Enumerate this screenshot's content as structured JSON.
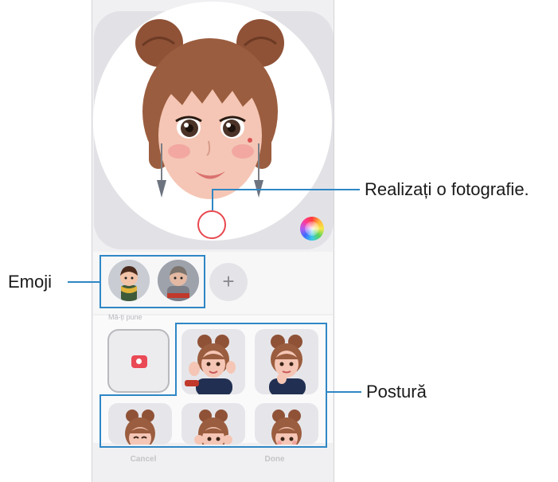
{
  "callouts": {
    "take_photo": "Realizați o fotografie.",
    "emoji": "Emoji",
    "pose": "Postură"
  },
  "sections": {
    "poses_label": "Mă-ți pune"
  },
  "buttons": {
    "add_emoji": "+",
    "cancel": "Cancel",
    "done": "Done"
  },
  "icons": {
    "shutter": "shutter-button-icon",
    "color_wheel": "color-palette-icon",
    "camera": "camera-icon",
    "add": "plus-icon"
  },
  "colors": {
    "callout_line": "#2f87c5",
    "shutter_ring": "#e8474e",
    "camera_button": "#ea4a55",
    "hair": "#9b5d3f",
    "skin": "#f5c6b5"
  }
}
